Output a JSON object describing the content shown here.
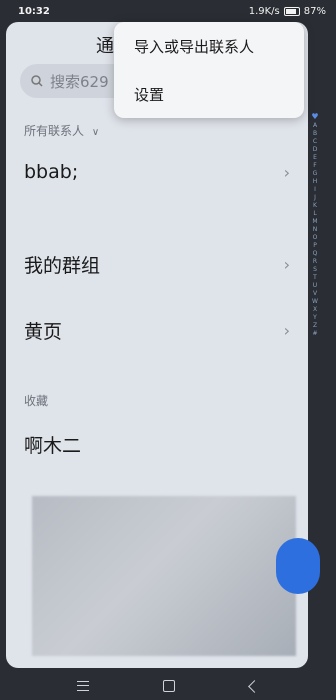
{
  "status_bar": {
    "time": "10:32",
    "network": "1.9K/s",
    "battery": "87%"
  },
  "header": {
    "title_partial": "通"
  },
  "search": {
    "placeholder": "搜索629"
  },
  "contacts": {
    "section_all": "所有联系人",
    "row_bbab": "bbab;",
    "row_groups": "我的群组",
    "row_yellow_pages": "黄页",
    "section_favorites": "收藏",
    "favorite_1": "啊木二"
  },
  "menu": {
    "item_import_export": "导入或导出联系人",
    "item_settings": "设置"
  },
  "alphabet": [
    "A",
    "B",
    "C",
    "D",
    "E",
    "F",
    "G",
    "H",
    "I",
    "J",
    "K",
    "L",
    "M",
    "N",
    "O",
    "P",
    "Q",
    "R",
    "S",
    "T",
    "U",
    "V",
    "W",
    "X",
    "Y",
    "Z",
    "#"
  ]
}
